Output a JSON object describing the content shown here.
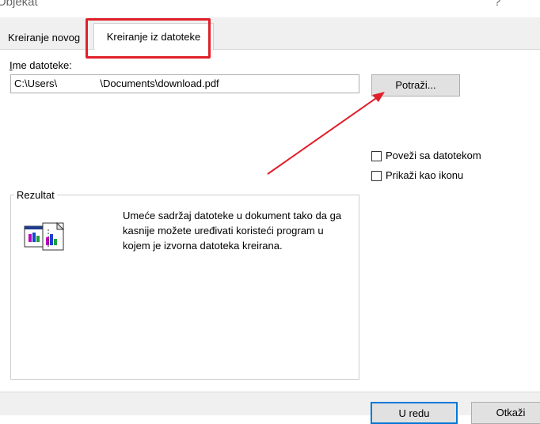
{
  "window": {
    "title": "Objekat",
    "help_symbol": "?"
  },
  "tabs": [
    {
      "label": "Kreiranje novog",
      "active": false
    },
    {
      "label": "Kreiranje iz datoteke",
      "active": true
    }
  ],
  "file": {
    "label": "Ime datoteke:",
    "value_part1": "C:\\Users\\",
    "value_part2": "\\Documents\\download.pdf",
    "browse_label": "Potraži..."
  },
  "options": {
    "link_label": "Poveži sa datotekom",
    "link_checked": false,
    "icon_label": "Prikaži kao ikonu",
    "icon_checked": false
  },
  "result": {
    "title": "Rezultat",
    "description": "Umeće sadržaj datoteke u dokument tako da ga kasnije možete uređivati koristeći program u kojem je izvorna datoteka kreirana."
  },
  "buttons": {
    "ok_label": "U redu",
    "cancel_label": "Otkaži"
  },
  "annotation": {
    "highlight_color": "#e0202a",
    "arrow_color": "#e0202a"
  }
}
